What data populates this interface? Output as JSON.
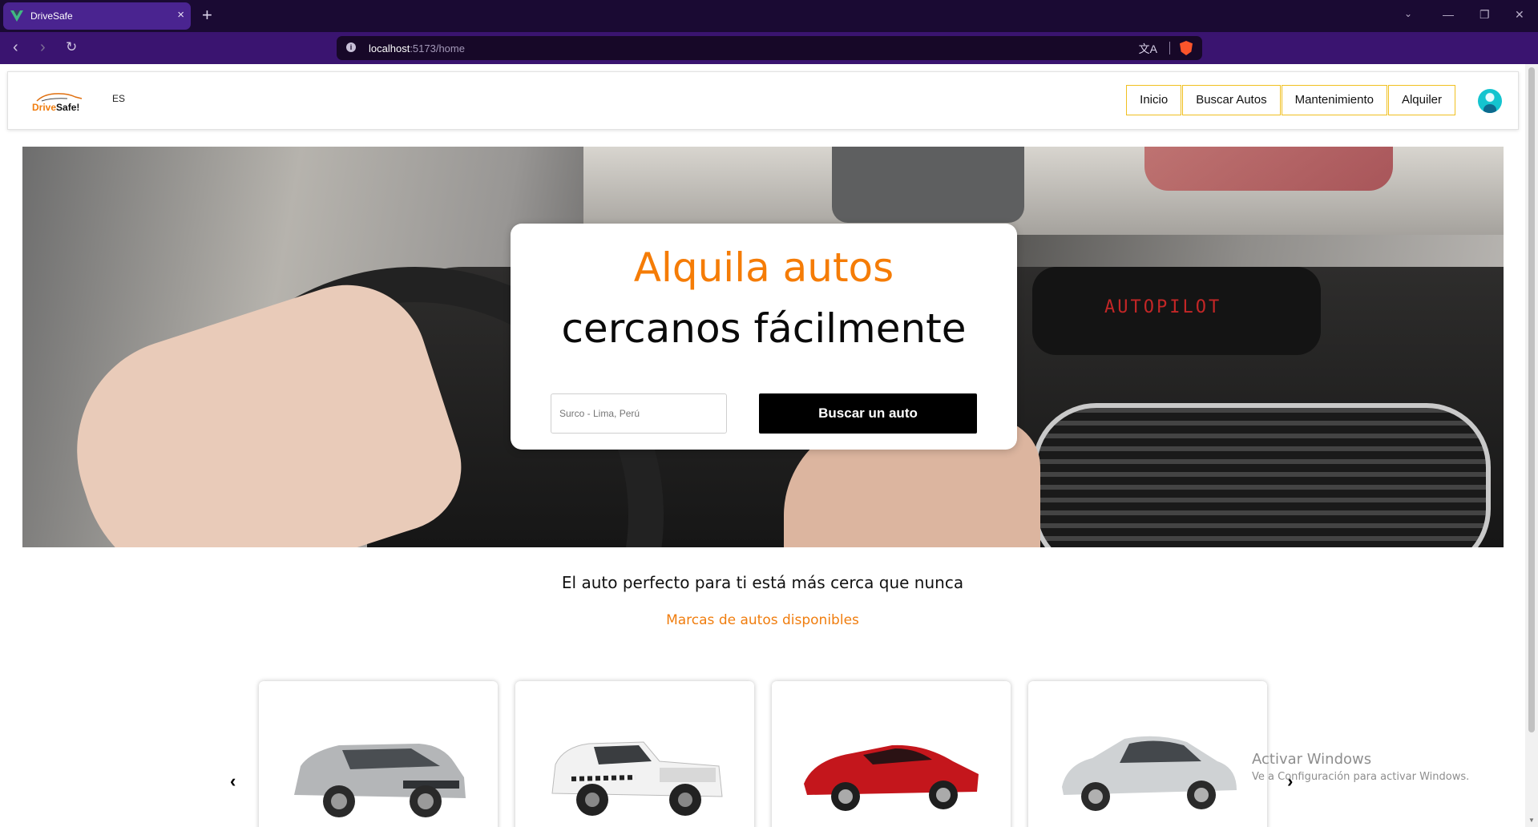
{
  "browser": {
    "tab_title": "DriveSafe",
    "tab_close": "×",
    "new_tab": "+",
    "url_host": "localhost",
    "url_path": ":5173/home",
    "minimize": "—",
    "restore": "❐",
    "close": "✕",
    "back": "‹",
    "forward": "›",
    "reload": "↻",
    "translate_icon": "文A",
    "menu_icon": "≡",
    "brand_color": "#4a2490"
  },
  "header": {
    "logo_prefix": "Drive",
    "logo_suffix": "Safe!",
    "language": "ES",
    "nav": [
      "Inicio",
      "Buscar Autos",
      "Mantenimiento",
      "Alquiler"
    ],
    "accent": "#f0c020"
  },
  "hero": {
    "dashboard_display": "AUTOPILOT",
    "headline_orange": "Alquila autos",
    "headline_black": "cercanos fácilmente",
    "search_placeholder": "Surco - Lima, Perú",
    "search_button": "Buscar un auto",
    "accent": "#f57c06"
  },
  "section": {
    "tagline": "El auto perfecto para ti está más cerca que nunca",
    "subtitle": "Marcas de autos disponibles"
  },
  "carousel": {
    "prev_icon": "‹",
    "next_icon": "›",
    "cars": [
      {
        "icon": "suv-silver-icon",
        "color": "#b4b6b8"
      },
      {
        "icon": "pickup-white-icon",
        "color": "#f2f2f2"
      },
      {
        "icon": "coupe-red-icon",
        "color": "#c4161c"
      },
      {
        "icon": "sedan-silver-icon",
        "color": "#cfd2d4"
      }
    ]
  },
  "watermark": {
    "title": "Activar Windows",
    "subtitle": "Ve a Configuración para activar Windows."
  }
}
